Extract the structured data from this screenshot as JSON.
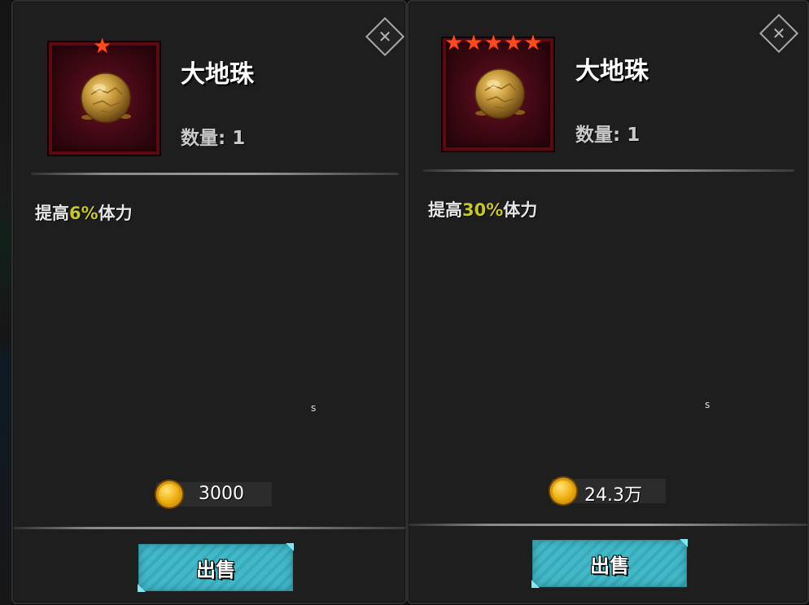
{
  "panels": [
    {
      "close_icon": "close-x-icon",
      "item": {
        "name": "大地珠",
        "quantity": "数量: 1",
        "stars": 1,
        "star_glyph": "★",
        "icon": "earth-orb-icon"
      },
      "effect": {
        "prefix": "提高",
        "value": "6%",
        "suffix": "体力"
      },
      "s_mark": "s",
      "price": "3000",
      "coin_icon": "gold-coin-icon",
      "sell_label": "出售"
    },
    {
      "close_icon": "close-x-icon",
      "item": {
        "name": "大地珠",
        "quantity": "数量: 1",
        "stars": 5,
        "star_glyph": "★",
        "icon": "earth-orb-icon"
      },
      "effect": {
        "prefix": "提高",
        "value": "30%",
        "suffix": "体力"
      },
      "s_mark": "s",
      "price": "24.3万",
      "coin_icon": "gold-coin-icon",
      "sell_label": "出售"
    }
  ],
  "colors": {
    "panel_bg": "#1e1e1e",
    "highlight": "#c6c827",
    "star": "#ff4a1c",
    "sell_button": "#41b9c9",
    "item_frame": "#5a0a10"
  }
}
